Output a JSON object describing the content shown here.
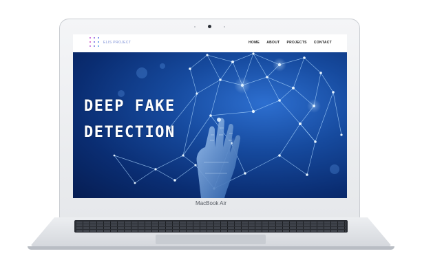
{
  "site": {
    "brand": "ELIS PROJECT",
    "nav": [
      {
        "label": "HOME"
      },
      {
        "label": "ABOUT"
      },
      {
        "label": "PROJECTS"
      },
      {
        "label": "CONTACT"
      }
    ]
  },
  "hero": {
    "headline_line1": "DEEP FAKE",
    "headline_line2": "DETECTION"
  },
  "device": {
    "model_label": "MacBook Air"
  },
  "colors": {
    "hero_blue": "#0b2d74",
    "network_glow": "#9fd3ff",
    "nav_text": "#1b1b1b"
  }
}
